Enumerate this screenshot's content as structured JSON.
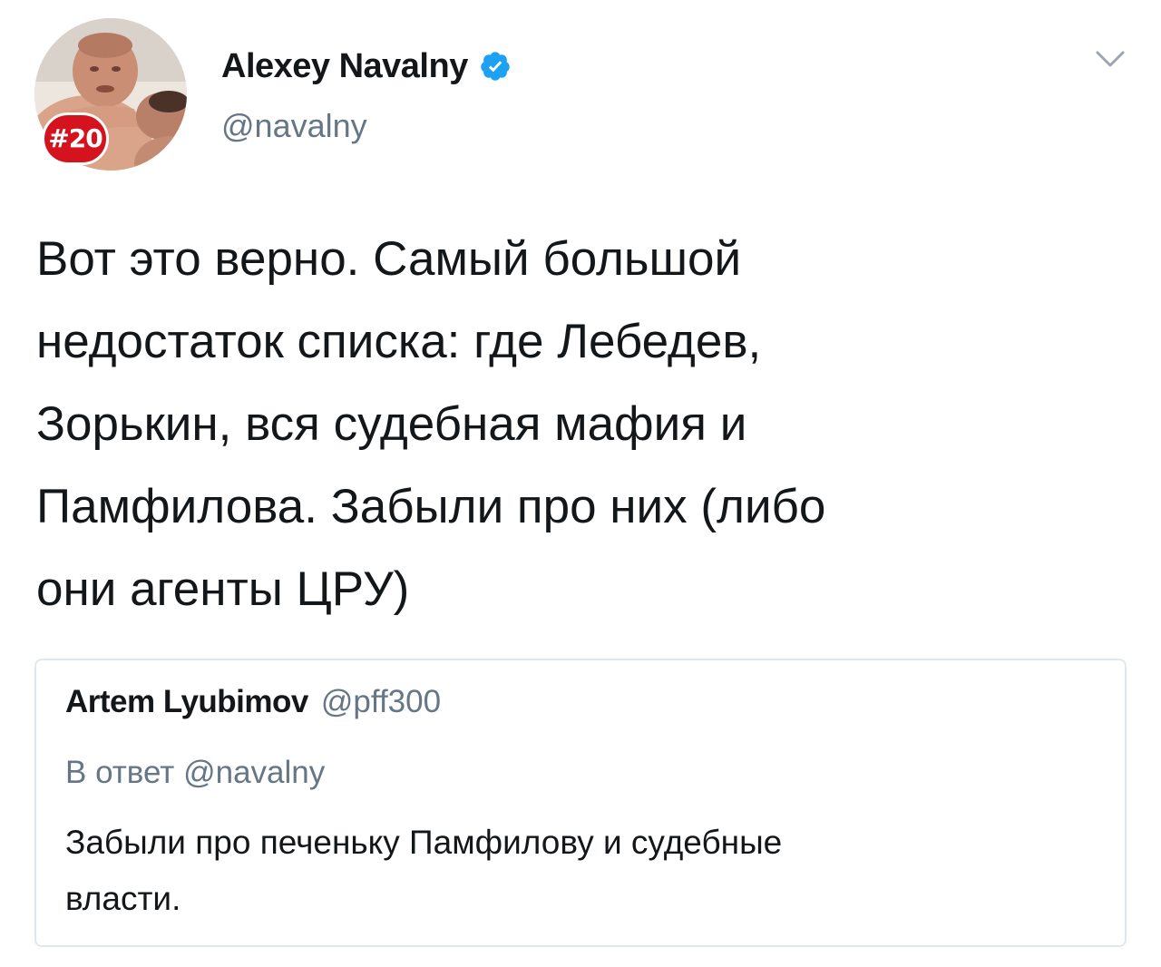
{
  "tweet": {
    "author": {
      "display_name": "Alexey Navalny",
      "handle": "@navalny",
      "verified": true,
      "avatar_badge": "#20",
      "verified_icon": "verified-badge-icon",
      "menu_icon": "chevron-down-icon"
    },
    "text": "Вот это верно. Самый большой\nнедостаток списка: где Лебедев,\nЗорькин, вся судебная мафия и\nПамфилова. Забыли про них (либо\nони агенты ЦРУ)",
    "quoted": {
      "author_name": "Artem Lyubimov",
      "author_handle": "@pff300",
      "reply_prefix": "В ответ",
      "reply_to": "@navalny",
      "text": "Забыли про печеньку Памфилову и судебные\nвласти."
    }
  },
  "colors": {
    "text_primary": "#14171a",
    "text_secondary": "#657786",
    "verified_blue": "#1da1f2",
    "badge_red": "#d4131f",
    "card_border": "#e1e8ed"
  }
}
